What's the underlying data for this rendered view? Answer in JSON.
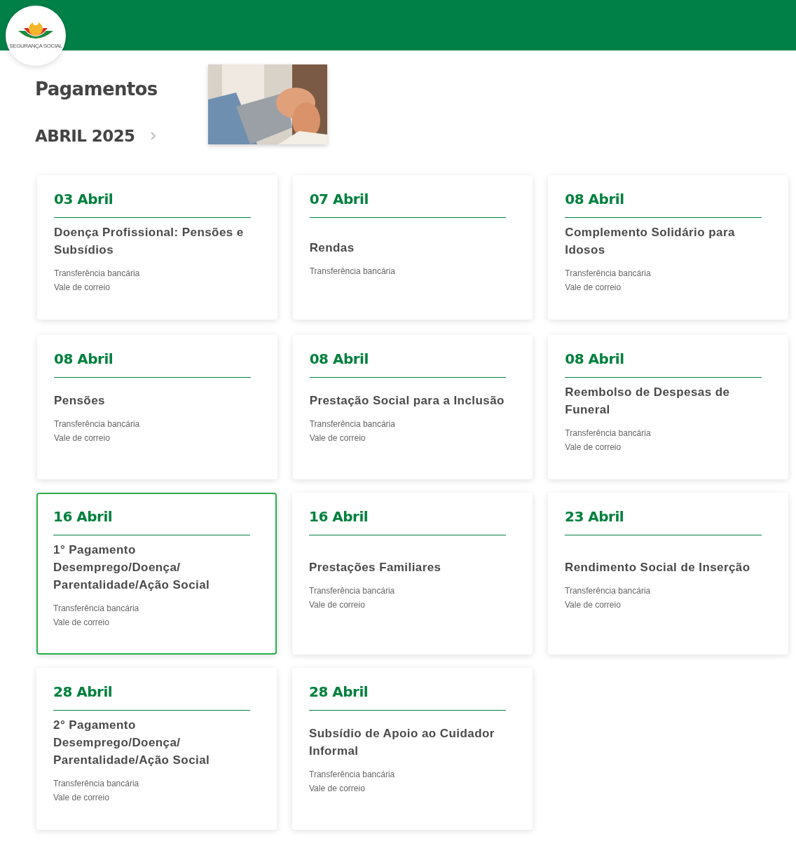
{
  "header": {
    "logo_text": "SEGURANÇA SOCIAL"
  },
  "page_title": "Pagamentos",
  "month": "ABRIL 2025",
  "cards": [
    {
      "date": "03 Abril",
      "title_lines": [
        "Doença Profissional: Pensões e Subsídios"
      ],
      "methods": [
        "Transferência bancária",
        "Vale de correio"
      ],
      "focused": false
    },
    {
      "date": "07 Abril",
      "title_lines": [
        "Rendas"
      ],
      "methods": [
        "Transferência bancária"
      ],
      "focused": false
    },
    {
      "date": "08 Abril",
      "title_lines": [
        "Complemento Solidário para Idosos"
      ],
      "methods": [
        "Transferência bancária",
        "Vale de correio"
      ],
      "focused": false
    },
    {
      "date": "08 Abril",
      "title_lines": [
        "Pensões"
      ],
      "methods": [
        "Transferência bancária",
        "Vale de correio"
      ],
      "focused": false
    },
    {
      "date": "08 Abril",
      "title_lines": [
        "Prestação Social para a Inclusão"
      ],
      "methods": [
        "Transferência bancária",
        "Vale de correio"
      ],
      "focused": false
    },
    {
      "date": "08 Abril",
      "title_lines": [
        "Reembolso de Despesas de Funeral"
      ],
      "methods": [
        "Transferência bancária",
        "Vale de correio"
      ],
      "focused": false
    },
    {
      "date": "16 Abril",
      "title_lines": [
        "1° Pagamento",
        "Desemprego/Doença/",
        "Parentalidade/Ação Social"
      ],
      "methods": [
        "Transferência bancária",
        "Vale de correio"
      ],
      "focused": true
    },
    {
      "date": "16 Abril",
      "title_lines": [
        "Prestações Familiares"
      ],
      "methods": [
        "Transferência bancária",
        "Vale de correio"
      ],
      "focused": false
    },
    {
      "date": "23 Abril",
      "title_lines": [
        "Rendimento Social de Inserção"
      ],
      "methods": [
        "Transferência bancária",
        "Vale de correio"
      ],
      "focused": false
    },
    {
      "date": "28 Abril",
      "title_lines": [
        "2° Pagamento",
        "Desemprego/Doença/",
        "Parentalidade/Ação Social"
      ],
      "methods": [
        "Transferência bancária",
        "Vale de correio"
      ],
      "focused": false
    },
    {
      "date": "28 Abril",
      "title_lines": [
        "Subsídio de Apoio ao Cuidador Informal"
      ],
      "methods": [
        "Transferência bancária",
        "Vale de correio"
      ],
      "focused": false
    }
  ]
}
